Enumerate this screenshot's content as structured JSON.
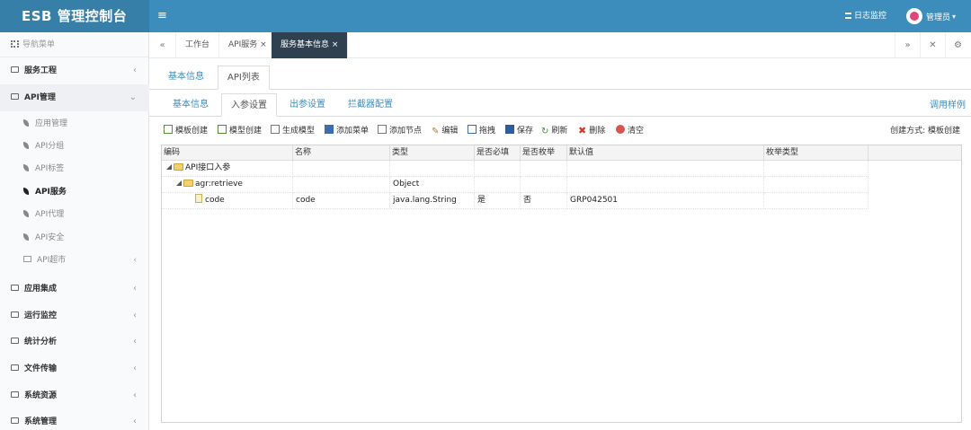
{
  "header": {
    "title": "ESB 管理控制台",
    "menu_toggle": "≡",
    "log_monitor": "日志监控",
    "user_name": "管理员"
  },
  "sidebar": {
    "nav_title": "导航菜单",
    "items": [
      {
        "label": "服务工程",
        "arrow": "‹"
      },
      {
        "label": "API管理",
        "arrow": "⌄"
      },
      {
        "label": "应用集成",
        "arrow": "‹"
      },
      {
        "label": "运行监控",
        "arrow": "‹"
      },
      {
        "label": "统计分析",
        "arrow": "‹"
      },
      {
        "label": "文件传输",
        "arrow": "‹"
      },
      {
        "label": "系统资源",
        "arrow": "‹"
      },
      {
        "label": "系统管理",
        "arrow": "‹"
      }
    ],
    "api_sub_items": [
      {
        "label": "应用管理"
      },
      {
        "label": "API分组"
      },
      {
        "label": "API标签"
      },
      {
        "label": "API服务"
      },
      {
        "label": "API代理"
      },
      {
        "label": "API安全"
      },
      {
        "label": "API超市",
        "arrow": "‹"
      }
    ]
  },
  "page_tabs": [
    {
      "label": "工作台"
    },
    {
      "label": "API服务",
      "close": "×"
    },
    {
      "label": "服务基本信息",
      "close": "×"
    }
  ],
  "tab_controls": {
    "back": "«",
    "forward": "»",
    "fullscreen": "✕",
    "settings": "⚙"
  },
  "top_tabs": [
    {
      "label": "基本信息"
    },
    {
      "label": "API列表"
    }
  ],
  "sub_tabs": [
    {
      "label": "基本信息"
    },
    {
      "label": "入参设置"
    },
    {
      "label": "出参设置"
    },
    {
      "label": "拦截器配置"
    }
  ],
  "sample_link": "调用样例",
  "toolbar": {
    "buttons": [
      {
        "label": "模板创建",
        "color": "#5a8f3a"
      },
      {
        "label": "模型创建",
        "color": "#5a8f3a"
      },
      {
        "label": "生成模型",
        "color": "#3a8f3a"
      },
      {
        "label": "添加菜单",
        "color": "#3b6ea8"
      },
      {
        "label": "添加节点",
        "color": "#4a9a3a"
      },
      {
        "label": "编辑",
        "color": "#b07a3a"
      },
      {
        "label": "拖拽",
        "color": "#3b6ea8"
      },
      {
        "label": "保存",
        "color": "#2f5c9a"
      },
      {
        "label": "刷新",
        "color": "#3a8f3a"
      },
      {
        "label": "删除",
        "color": "#d43a2a"
      },
      {
        "label": "清空",
        "color": "#d9534f"
      }
    ],
    "create_mode_label": "创建方式:",
    "create_mode_value": "模板创建"
  },
  "table": {
    "columns": [
      "编码",
      "名称",
      "类型",
      "是否必填",
      "是否枚举",
      "默认值",
      "枚举类型"
    ],
    "rows": [
      {
        "code": "API接口入参",
        "name": "",
        "type": "",
        "required": "",
        "enum": "",
        "default": "",
        "enum_type": ""
      },
      {
        "code": "agr:retrieve",
        "name": "",
        "type": "Object",
        "required": "",
        "enum": "",
        "default": "",
        "enum_type": ""
      },
      {
        "code": "code",
        "name": "code",
        "type": "java.lang.String",
        "required": "是",
        "enum": "否",
        "default": "GRP042501",
        "enum_type": ""
      }
    ]
  }
}
